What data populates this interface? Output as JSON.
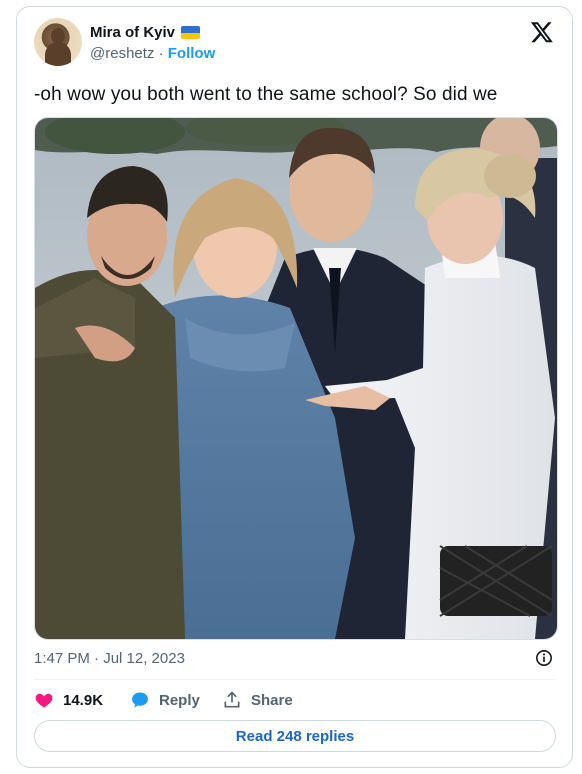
{
  "tweet": {
    "author": {
      "display_name": "Mira of Kyiv",
      "handle": "@reshetz",
      "separator": "·",
      "follow_label": "Follow"
    },
    "text": "-oh wow you both went to the same school? So did we",
    "timestamp": "1:47 PM · Jul 12, 2023",
    "likes": "14.9K",
    "reply_label": "Reply",
    "share_label": "Share",
    "read_replies_label": "Read 248 replies"
  },
  "colors": {
    "accent": "#1d9bf0",
    "like": "#f91880",
    "border": "#cfd9de",
    "muted": "#536471",
    "flag_blue": "#2f6fd0",
    "flag_yellow": "#f5c40d"
  },
  "icons": [
    "x-logo-icon",
    "ukraine-flag-icon",
    "info-icon",
    "heart-icon",
    "reply-bubble-icon",
    "share-icon"
  ]
}
